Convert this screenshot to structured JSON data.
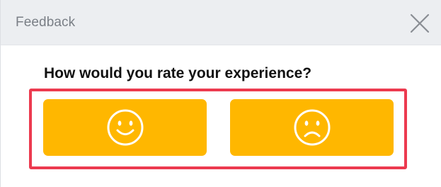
{
  "dialog": {
    "title": "Feedback",
    "close_icon": "close-icon",
    "question": "How would you rate your experience?",
    "buttons": [
      {
        "name": "positive-rating-button",
        "icon": "smiley-face-icon"
      },
      {
        "name": "negative-rating-button",
        "icon": "sad-face-icon"
      }
    ],
    "highlight_color": "#ec3a4f",
    "button_color": "#ffb700",
    "header_bg": "#eceef1"
  }
}
